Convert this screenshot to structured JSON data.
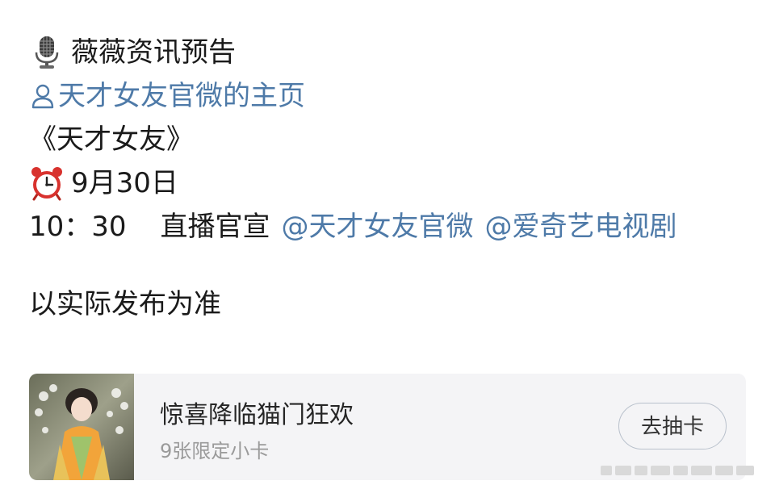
{
  "post": {
    "heading": "薇薇资讯预告",
    "heading_icon": "microphone-icon",
    "profile_link": "天才女友官微的主页",
    "profile_icon": "person-outline-icon",
    "work_title": "《天才女友》",
    "date_icon": "alarm-clock-icon",
    "date": "9月30日",
    "time": "10：30",
    "event": "直播官宣",
    "mentions": [
      "@天才女友官微",
      "@爱奇艺电视剧"
    ],
    "note": "以实际发布为准"
  },
  "card": {
    "title": "惊喜降临猫门狂欢",
    "subtitle": "9张限定小卡",
    "button_label": "去抽卡"
  },
  "colors": {
    "link": "#4e7aa8",
    "card_bg": "#f4f4f6",
    "subtitle": "#9a9a9a"
  }
}
